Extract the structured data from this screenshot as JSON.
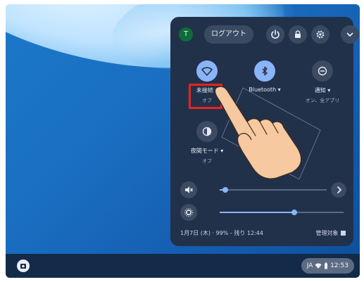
{
  "topbar": {
    "avatar_initial": "T",
    "logout_label": "ログアウト"
  },
  "tiles": [
    {
      "label": "未接続 ▾",
      "sublabel": "オフ",
      "icon": "wifi-icon"
    },
    {
      "label": "Bluetooth ▾",
      "sublabel": "",
      "icon": "bluetooth-icon"
    },
    {
      "label": "通知 ▾",
      "sublabel": "オン、全アプリ",
      "icon": "notification-icon"
    },
    {
      "label": "夜間モード ▾",
      "sublabel": "オフ",
      "icon": "night-light-icon"
    }
  ],
  "sliders": {
    "volume": {
      "level": 0.05
    },
    "brightness": {
      "level": 0.6
    }
  },
  "footer": {
    "date_battery": "1月7日 (木) · 99% - 残り 12:44",
    "managed": "管理対象"
  },
  "shelf": {
    "status_text": "JA",
    "time": "12:53"
  },
  "colors": {
    "panel": "#22314a",
    "accent": "#8ab4f8",
    "highlight": "#e8231c"
  }
}
